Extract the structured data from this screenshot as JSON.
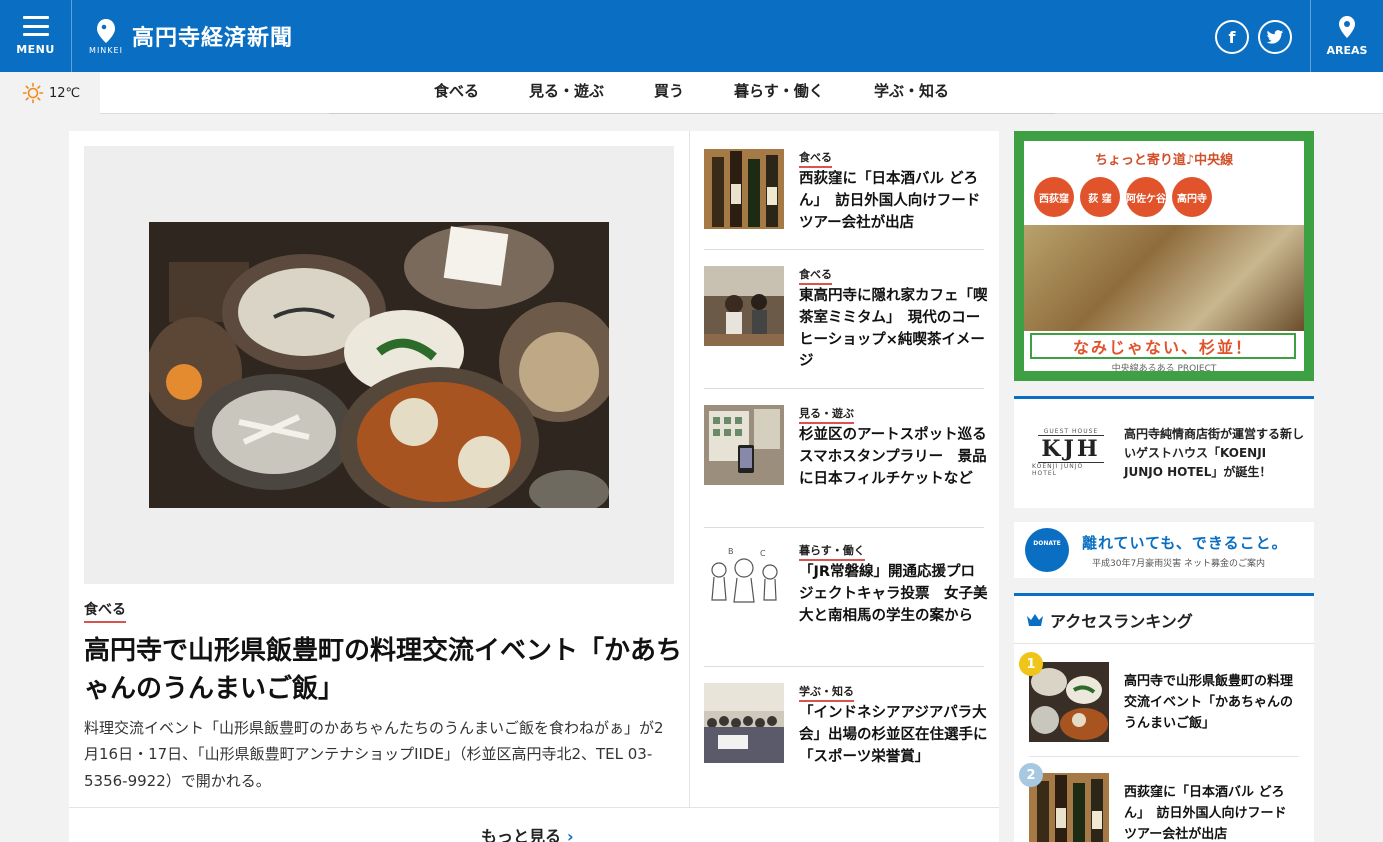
{
  "header": {
    "menu_label": "MENU",
    "brand_sub": "MINKEI",
    "site_title": "高円寺経済新聞",
    "areas_label": "AREAS",
    "facebook_glyph": "f",
    "brand_color": "#0a6fc2"
  },
  "weather": {
    "temperature": "12℃",
    "icon": "sun-icon"
  },
  "categories": [
    "食べる",
    "見る・遊ぶ",
    "買う",
    "暮らす・働く",
    "学ぶ・知る"
  ],
  "featured": {
    "category": "食べる",
    "title": "高円寺で山形県飯豊町の料理交流イベント「かあちゃんのうんまいご飯」",
    "description": "料理交流イベント「山形県飯豊町のかあちゃんたちのうんまいご飯を食わねがぁ」が2月16日・17日、「山形県飯豊町アンテナショップIIDE」（杉並区高円寺北2、TEL 03-5356-9922）で開かれる。"
  },
  "news": [
    {
      "category": "食べる",
      "title": "西荻窪に「日本酒バル どろん」　訪日外国人向けフードツアー会社が出店"
    },
    {
      "category": "食べる",
      "title": "東高円寺に隠れ家カフェ「喫茶室ミミタム」　現代のコーヒーショップ×純喫茶イメージ"
    },
    {
      "category": "見る・遊ぶ",
      "title": "杉並区のアートスポット巡るスマホスタンプラリー　景品に日本フィルチケットなど"
    },
    {
      "category": "暮らす・働く",
      "title": "「JR常磐線」開通応援プロジェクトキャラ投票　女子美大と南相馬の学生の案から"
    },
    {
      "category": "学ぶ・知る",
      "title": "「インドネシアアジアパラ大会」出場の杉並区在住選手に「スポーツ栄誉賞」"
    }
  ],
  "more_label": "もっと見る",
  "ad": {
    "top_text": "ちょっと寄り道♪中央線",
    "stations": [
      "西荻窪",
      "荻 窪",
      "阿佐ケ谷",
      "高円寺"
    ],
    "slogan": "なみじゃない、杉並！",
    "sub": "中央線あるある PROJECT"
  },
  "kjh": {
    "logo_text": "KJH",
    "logo_top": "GUEST HOUSE",
    "logo_bottom": "KOENJI JUNJO HOTEL",
    "text": "高円寺純情商店街が運営する新しいゲストハウス「KOENJI JUNJO HOTEL」が誕生！"
  },
  "donate": {
    "icon_label": "DONATE",
    "main": "離れていても、できること。",
    "sub": "平成30年7月豪雨災害 ネット募金のご案内"
  },
  "ranking": {
    "title": "アクセスランキング",
    "items": [
      {
        "rank": "1",
        "title": "高円寺で山形県飯豊町の料理交流イベント「かあちゃんのうんまいご飯」",
        "badge_color": "#f0c419"
      },
      {
        "rank": "2",
        "title": "西荻窪に「日本酒バル どろん」　訪日外国人向けフードツアー会社が出店",
        "badge_color": "#a6c8e0"
      }
    ]
  }
}
